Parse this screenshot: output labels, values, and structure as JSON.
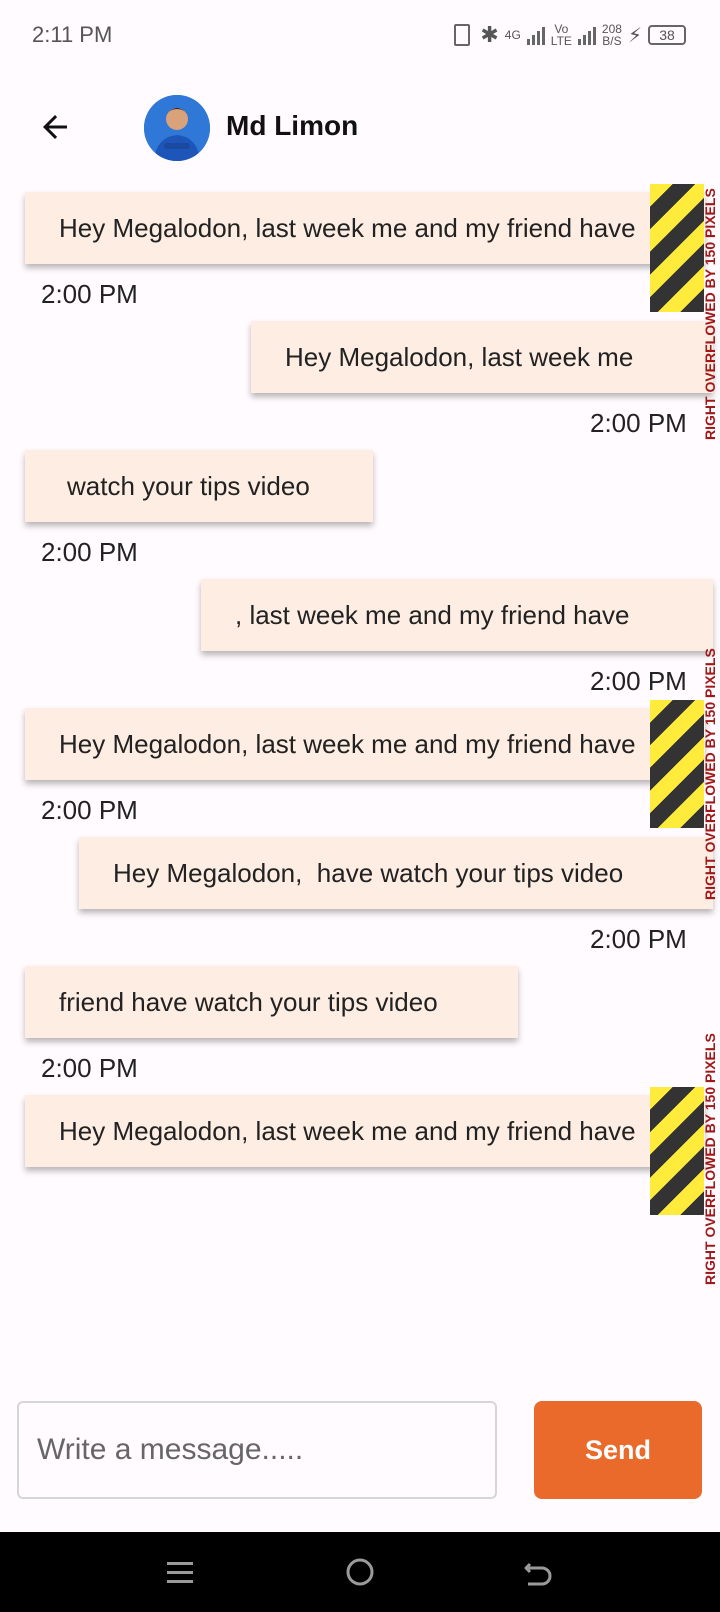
{
  "status_bar": {
    "time": "2:11 PM",
    "network_primary": "4G",
    "network_secondary": "Vo\nLTE",
    "speed": "208\nB/S",
    "battery": "38"
  },
  "header": {
    "contact_name": "Md Limon",
    "back_icon": "arrow-left-icon"
  },
  "messages": [
    {
      "text": "Hey Megalodon, last week me and my friend have",
      "time": "2:00 PM",
      "side": "received",
      "overflow": true
    },
    {
      "text": "Hey Megalodon, last week me",
      "time": "2:00 PM",
      "side": "sent",
      "overflow": false
    },
    {
      "text": "watch your tips video",
      "time": "2:00 PM",
      "side": "received",
      "overflow": false
    },
    {
      "text": ", last week me and my friend have",
      "time": "2:00 PM",
      "side": "sent",
      "overflow": false
    },
    {
      "text": "Hey Megalodon, last week me and my friend have",
      "time": "2:00 PM",
      "side": "received",
      "overflow": true
    },
    {
      "text": "Hey Megalodon,  have watch your tips video",
      "time": "2:00 PM",
      "side": "sent",
      "overflow": false
    },
    {
      "text": "friend have watch your tips video",
      "time": "2:00 PM",
      "side": "received",
      "overflow": false
    },
    {
      "text": "Hey Megalodon, last week me and my friend have",
      "time": "",
      "side": "received",
      "overflow": true
    }
  ],
  "overflow_warnings": [
    "RIGHT OVERFLOWED BY 150 PIXELS",
    "RIGHT OVERFLOWED BY 150 PIXELS",
    "RIGHT OVERFLOWED BY 150 PIXELS"
  ],
  "composer": {
    "placeholder": "Write a message.....",
    "value": "",
    "send_label": "Send"
  },
  "colors": {
    "bubble": "#fdede3",
    "send_button": "#ea6a2b",
    "background": "#fffbfe",
    "overflow_text": "#a01818"
  }
}
